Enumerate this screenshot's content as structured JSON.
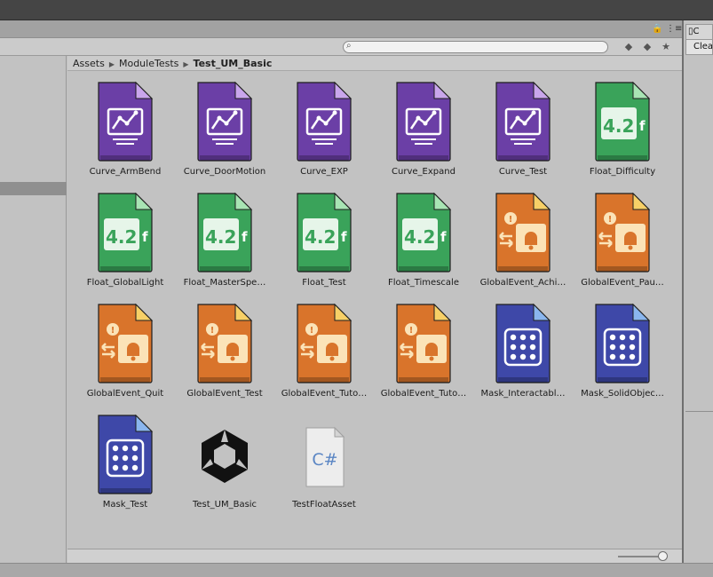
{
  "window": {
    "lock_glyph": "🔒",
    "menu_glyph": "⋮≡"
  },
  "toolbar": {
    "search_placeholder": "",
    "search_glyph": "⌕",
    "type_filter_glyph": "◆",
    "label_filter_glyph": "◆",
    "favorite_glyph": "★"
  },
  "breadcrumb": {
    "items": [
      "Assets",
      "ModuleTests",
      "Test_UM_Basic"
    ],
    "separator": "▶"
  },
  "assets": [
    {
      "name": "Curve_ArmBend",
      "kind": "curve"
    },
    {
      "name": "Curve_DoorMotion",
      "kind": "curve"
    },
    {
      "name": "Curve_EXP",
      "kind": "curve"
    },
    {
      "name": "Curve_Expand",
      "kind": "curve"
    },
    {
      "name": "Curve_Test",
      "kind": "curve"
    },
    {
      "name": "Float_Difficulty",
      "kind": "float"
    },
    {
      "name": "Float_GlobalLight",
      "kind": "float"
    },
    {
      "name": "Float_MasterSpe…",
      "kind": "float"
    },
    {
      "name": "Float_Test",
      "kind": "float"
    },
    {
      "name": "Float_Timescale",
      "kind": "float"
    },
    {
      "name": "GlobalEvent_Achi…",
      "kind": "event"
    },
    {
      "name": "GlobalEvent_Pau…",
      "kind": "event"
    },
    {
      "name": "GlobalEvent_Quit",
      "kind": "event"
    },
    {
      "name": "GlobalEvent_Test",
      "kind": "event"
    },
    {
      "name": "GlobalEvent_Tuto…",
      "kind": "event"
    },
    {
      "name": "GlobalEvent_Tuto…",
      "kind": "event"
    },
    {
      "name": "Mask_Interactabl…",
      "kind": "mask"
    },
    {
      "name": "Mask_SolidObjec…",
      "kind": "mask"
    },
    {
      "name": "Mask_Test",
      "kind": "mask"
    },
    {
      "name": "Test_UM_Basic",
      "kind": "unity"
    },
    {
      "name": "TestFloatAsset",
      "kind": "csharp"
    }
  ],
  "icon_text": {
    "float_value": "4.2",
    "float_suffix": "f",
    "csharp": "C#",
    "event_mark": "!"
  },
  "inspector": {
    "tab_label": "C",
    "clear_button": "Clea"
  },
  "colors": {
    "curve": "#6b3fa6",
    "float": "#3aa35a",
    "event": "#d9742b",
    "mask": "#3e48a8",
    "accent": "#ffffff"
  },
  "icon_names": {
    "curve": "curve-icon",
    "float": "float-icon",
    "event": "global-event-icon",
    "mask": "mask-icon",
    "unity": "unity-scene-icon",
    "csharp": "csharp-script-icon"
  }
}
